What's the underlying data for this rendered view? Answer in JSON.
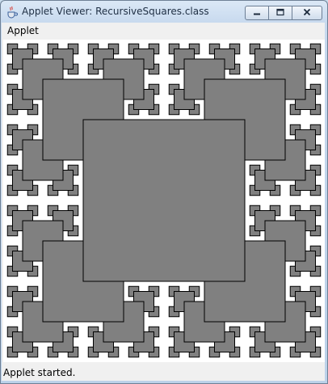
{
  "window": {
    "title": "Applet Viewer: RecursiveSquares.class",
    "controls": {
      "minimize": "minimize",
      "maximize": "maximize",
      "close": "close"
    }
  },
  "menubar": {
    "items": [
      {
        "label": "Applet"
      }
    ]
  },
  "applet": {
    "name": "RecursiveSquares",
    "fill_color": "#808080",
    "outline_color": "#000000",
    "background": "#ffffff",
    "recursion_depth": 5
  },
  "status": {
    "text": "Applet started."
  },
  "icons": {
    "app": "java-cup-icon",
    "minimize": "minimize-icon",
    "maximize": "maximize-icon",
    "close": "close-icon"
  }
}
